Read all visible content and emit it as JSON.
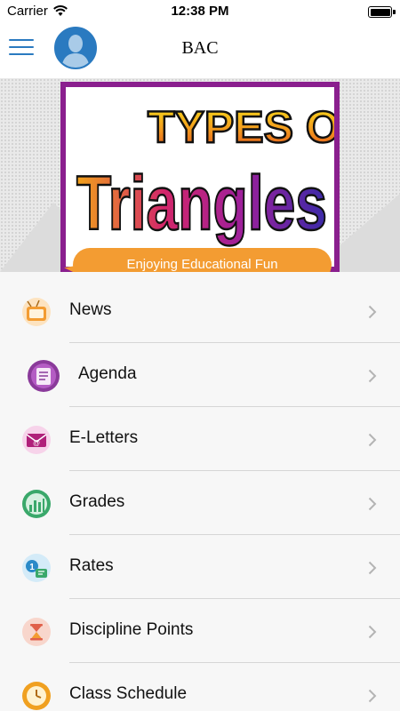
{
  "status_bar": {
    "carrier": "Carrier",
    "time": "12:38 PM",
    "battery_level": 1.0
  },
  "nav": {
    "title": "BAC",
    "menu_icon": "hamburger-icon",
    "avatar_icon": "user-avatar-icon"
  },
  "banner": {
    "poster_line1": "TYPES OF",
    "poster_line2": "Triangles",
    "tagline": "Enjoying Educational Fun"
  },
  "menu": {
    "items": [
      {
        "label": "News",
        "icon": "tv-news-icon",
        "color": "#f39c32"
      },
      {
        "label": "Agenda",
        "icon": "agenda-icon",
        "color": "#8a3a9a"
      },
      {
        "label": "E-Letters",
        "icon": "email-icon",
        "color": "#b0207a"
      },
      {
        "label": "Grades",
        "icon": "grades-chart-icon",
        "color": "#3aa86a"
      },
      {
        "label": "Rates",
        "icon": "rates-icon",
        "color": "#2a8ac8"
      },
      {
        "label": "Discipline Points",
        "icon": "hourglass-icon",
        "color": "#e0604a"
      },
      {
        "label": "Class Schedule",
        "icon": "clock-icon",
        "color": "#f0a020"
      }
    ]
  },
  "colors": {
    "accent": "#2a7ac0",
    "poster_border": "#8a1f8e",
    "tagline_bg": "#f39c32"
  }
}
